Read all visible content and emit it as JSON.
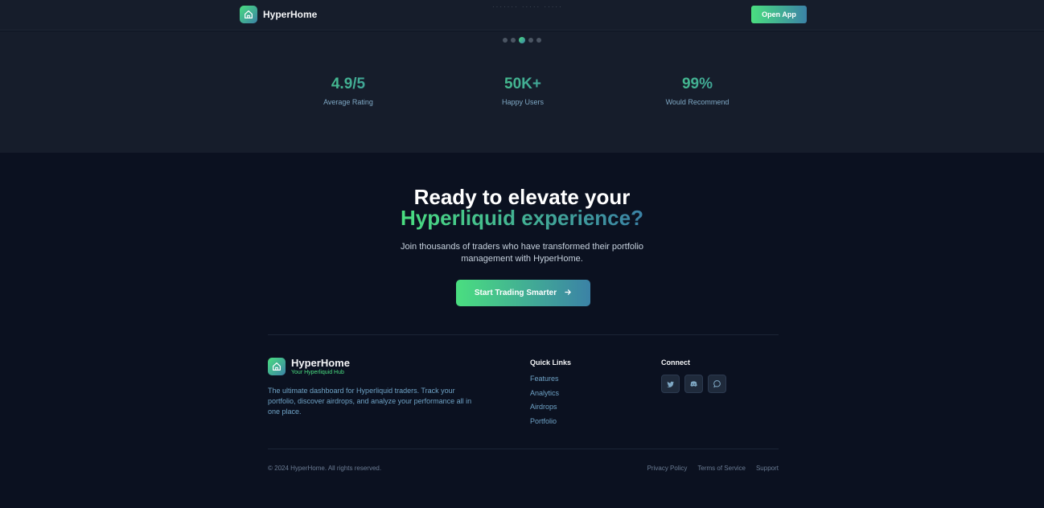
{
  "colors": {
    "accent_green": "#4ade80",
    "accent_blue": "#3b82a6",
    "background": "#0b1120",
    "panel": "#161d2b"
  },
  "header": {
    "brand_name": "HyperHome",
    "logo_icon": "house-icon",
    "open_app_label": "Open App"
  },
  "carousel": {
    "total": 5,
    "active_index": 2
  },
  "stats": [
    {
      "value": "4.9/5",
      "label": "Average Rating"
    },
    {
      "value": "50K+",
      "label": "Happy Users"
    },
    {
      "value": "99%",
      "label": "Would Recommend"
    }
  ],
  "cta": {
    "title_line1": "Ready to elevate your",
    "title_line2": "Hyperliquid experience?",
    "subtitle": "Join thousands of traders who have transformed their portfolio management with HyperHome.",
    "button_label": "Start Trading Smarter",
    "button_icon": "arrow-right-icon"
  },
  "footer": {
    "brand_name": "HyperHome",
    "tagline": "Your Hyperliquid Hub",
    "description": "The ultimate dashboard for Hyperliquid traders. Track your portfolio, discover airdrops, and analyze your performance all in one place.",
    "quick_links_title": "Quick Links",
    "quick_links": [
      "Features",
      "Analytics",
      "Airdrops",
      "Portfolio"
    ],
    "connect_title": "Connect",
    "socials": [
      "twitter-icon",
      "discord-icon",
      "chat-icon"
    ],
    "copyright": "© 2024 HyperHome. All rights reserved.",
    "legal_links": [
      "Privacy Policy",
      "Terms of Service",
      "Support"
    ]
  }
}
